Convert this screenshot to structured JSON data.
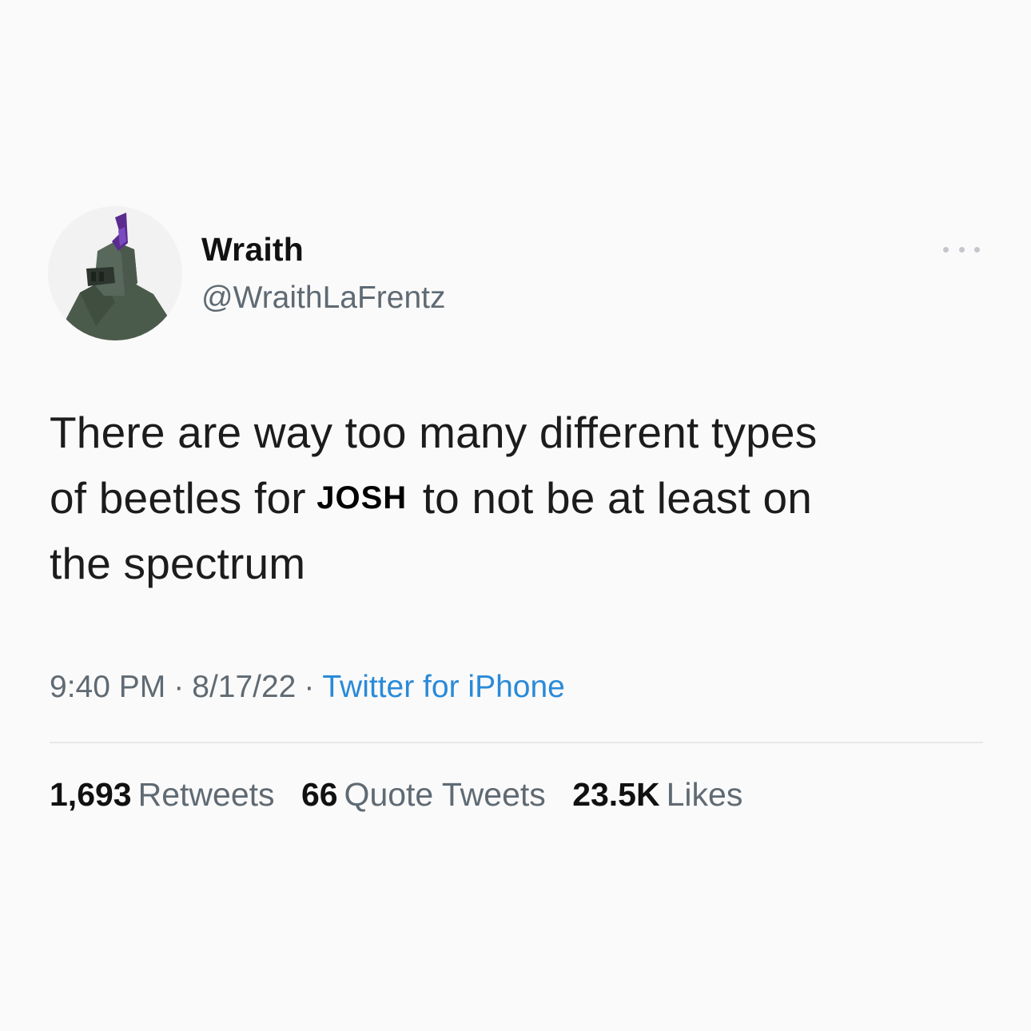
{
  "author": {
    "display_name": "Wraith",
    "handle": "@WraithLaFrentz",
    "avatar_icon": "knight-helmet-avatar-icon"
  },
  "menu": {
    "icon": "more-horizontal-icon"
  },
  "tweet": {
    "line1": "There are way too many different types",
    "line2_before": "of beetles for",
    "line2_overlay": "JOSH",
    "line2_after": "to not be at least on",
    "line3": "the spectrum"
  },
  "meta": {
    "time": "9:40 PM",
    "separator": "·",
    "date": "8/17/22",
    "source": "Twitter for iPhone",
    "source_color": "#2a8ad8"
  },
  "stats": {
    "retweets_count": "1,693",
    "retweets_label": "Retweets",
    "quotes_count": "66",
    "quotes_label": "Quote Tweets",
    "likes_count": "23.5K",
    "likes_label": "Likes"
  }
}
